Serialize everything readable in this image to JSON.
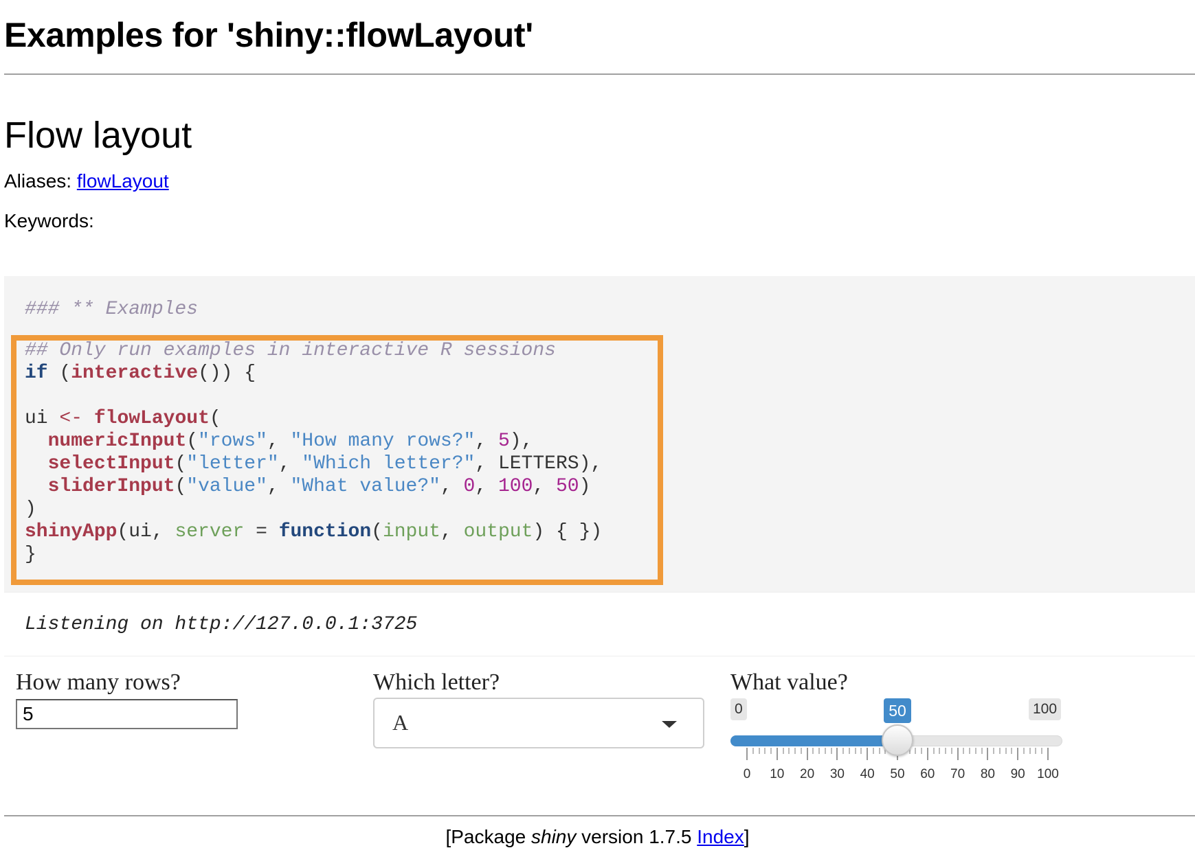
{
  "page": {
    "title": "Examples for 'shiny::flowLayout'",
    "section_title": "Flow layout",
    "aliases_label": "Aliases:",
    "aliases_link": "flowLayout",
    "keywords_label": "Keywords:"
  },
  "code": {
    "header_comment": "### ** Examples",
    "comment_line": "## Only run examples in interactive R sessions",
    "kw_if": "if",
    "fn_interactive": "interactive",
    "var_ui": "ui",
    "op_assign": "<-",
    "fn_flowLayout": "flowLayout",
    "fn_numericInput": "numericInput",
    "str_rows": "\"rows\"",
    "str_how_many": "\"How many rows?\"",
    "num_5": "5",
    "fn_selectInput": "selectInput",
    "str_letter": "\"letter\"",
    "str_which_letter": "\"Which letter?\"",
    "var_letters": "LETTERS",
    "fn_sliderInput": "sliderInput",
    "str_value": "\"value\"",
    "str_what_value": "\"What value?\"",
    "num_0": "0",
    "num_100": "100",
    "num_50": "50",
    "fn_shinyApp": "shinyApp",
    "arg_server": "server",
    "kw_function": "function",
    "arg_input": "input",
    "arg_output": "output"
  },
  "output": {
    "listening": "Listening on http://127.0.0.1:3725"
  },
  "app": {
    "numeric": {
      "label": "How many rows?",
      "value": "5"
    },
    "select": {
      "label": "Which letter?",
      "value": "A"
    },
    "slider": {
      "label": "What value?",
      "min_label": "0",
      "max_label": "100",
      "value_label": "50",
      "min": 0,
      "max": 100,
      "value": 50,
      "ticks": [
        "0",
        "10",
        "20",
        "30",
        "40",
        "50",
        "60",
        "70",
        "80",
        "90",
        "100"
      ]
    }
  },
  "footer": {
    "open_bracket": "[Package ",
    "package_name": "shiny",
    "version_text": " version 1.7.5 ",
    "index_link": "Index",
    "close_bracket": "]"
  },
  "colors": {
    "highlight_border": "#f09a3a",
    "code_bg": "#f4f4f4",
    "slider_accent": "#428bca",
    "link": "#0000ee"
  }
}
